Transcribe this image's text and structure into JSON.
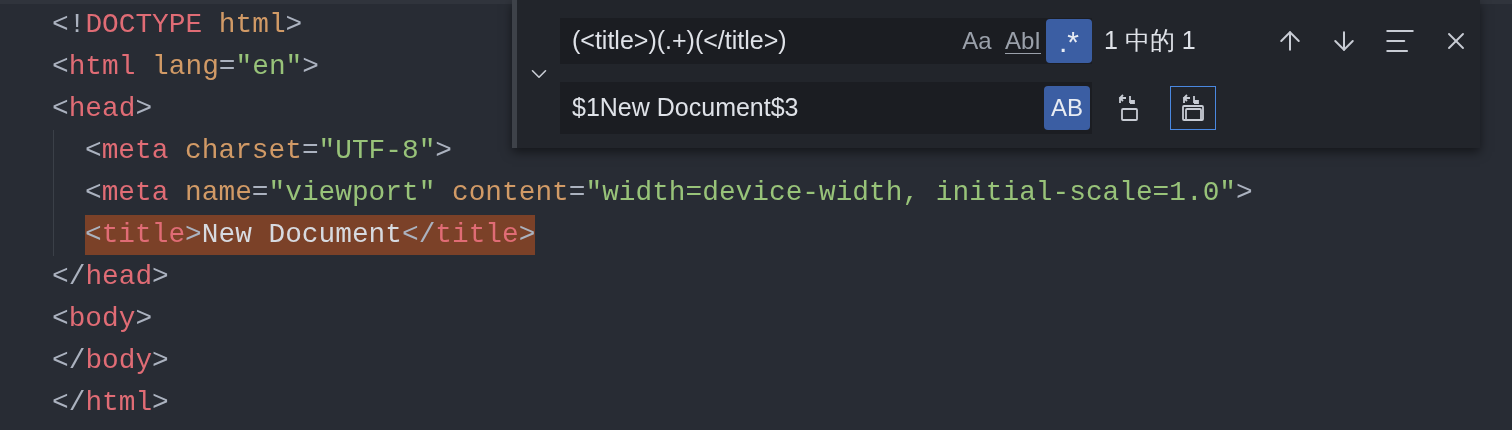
{
  "editor": {
    "lines": [
      {
        "tokens": [
          {
            "kind": "punct",
            "text": "<!"
          },
          {
            "kind": "tag",
            "text": "DOCTYPE"
          },
          {
            "kind": "attr",
            "text": " html"
          },
          {
            "kind": "punct",
            "text": ">"
          }
        ]
      },
      {
        "tokens": [
          {
            "kind": "punct",
            "text": "<"
          },
          {
            "kind": "tag",
            "text": "html"
          },
          {
            "kind": "attr",
            "text": " lang"
          },
          {
            "kind": "punct",
            "text": "="
          },
          {
            "kind": "string",
            "text": "\"en\""
          },
          {
            "kind": "punct",
            "text": ">"
          }
        ]
      },
      {
        "tokens": [
          {
            "kind": "punct",
            "text": "<"
          },
          {
            "kind": "tag",
            "text": "head"
          },
          {
            "kind": "punct",
            "text": ">"
          }
        ],
        "children": [
          {
            "tokens": [
              {
                "kind": "punct",
                "text": "<"
              },
              {
                "kind": "tag",
                "text": "meta"
              },
              {
                "kind": "attr",
                "text": " charset"
              },
              {
                "kind": "punct",
                "text": "="
              },
              {
                "kind": "string",
                "text": "\"UTF-8\""
              },
              {
                "kind": "punct",
                "text": ">"
              }
            ],
            "highlighted": false
          },
          {
            "tokens": [
              {
                "kind": "punct",
                "text": "<"
              },
              {
                "kind": "tag",
                "text": "meta"
              },
              {
                "kind": "attr",
                "text": " name"
              },
              {
                "kind": "punct",
                "text": "="
              },
              {
                "kind": "string",
                "text": "\"viewport\""
              },
              {
                "kind": "attr",
                "text": " content"
              },
              {
                "kind": "punct",
                "text": "="
              },
              {
                "kind": "string",
                "text": "\"width=device-width, initial-scale=1.0\""
              },
              {
                "kind": "punct",
                "text": ">"
              }
            ],
            "highlighted": false
          },
          {
            "tokens": [
              {
                "kind": "punct",
                "text": "<"
              },
              {
                "kind": "tag",
                "text": "title"
              },
              {
                "kind": "punct",
                "text": ">"
              },
              {
                "kind": "text",
                "text": "New Document"
              },
              {
                "kind": "punct",
                "text": "</"
              },
              {
                "kind": "tag",
                "text": "title"
              },
              {
                "kind": "punct",
                "text": ">"
              }
            ],
            "highlighted": true
          }
        ]
      },
      {
        "tokens": [
          {
            "kind": "punct",
            "text": "</"
          },
          {
            "kind": "tag",
            "text": "head"
          },
          {
            "kind": "punct",
            "text": ">"
          }
        ]
      },
      {
        "tokens": [
          {
            "kind": "punct",
            "text": "<"
          },
          {
            "kind": "tag",
            "text": "body"
          },
          {
            "kind": "punct",
            "text": ">"
          }
        ]
      },
      {
        "tokens": [
          {
            "kind": "punct",
            "text": "</"
          },
          {
            "kind": "tag",
            "text": "body"
          },
          {
            "kind": "punct",
            "text": ">"
          }
        ]
      },
      {
        "tokens": [
          {
            "kind": "punct",
            "text": "</"
          },
          {
            "kind": "tag",
            "text": "html"
          },
          {
            "kind": "punct",
            "text": ">"
          }
        ]
      }
    ]
  },
  "find_widget": {
    "expanded": true,
    "find": {
      "value": "(<title>)(.+)(</title>)",
      "options": [
        {
          "kind": "case",
          "label": "Aa",
          "selected": false
        },
        {
          "kind": "word",
          "label": "AbI",
          "selected": false
        },
        {
          "kind": "regex",
          "label": ".*",
          "selected": true
        }
      ],
      "count": "1 中的 1"
    },
    "replace": {
      "value": "$1New Document$3",
      "options": [
        {
          "kind": "preserve",
          "label": "AB",
          "selected": true
        }
      ],
      "actions": [
        {
          "kind": "one",
          "selected": false
        },
        {
          "kind": "all",
          "selected": true
        }
      ]
    }
  }
}
